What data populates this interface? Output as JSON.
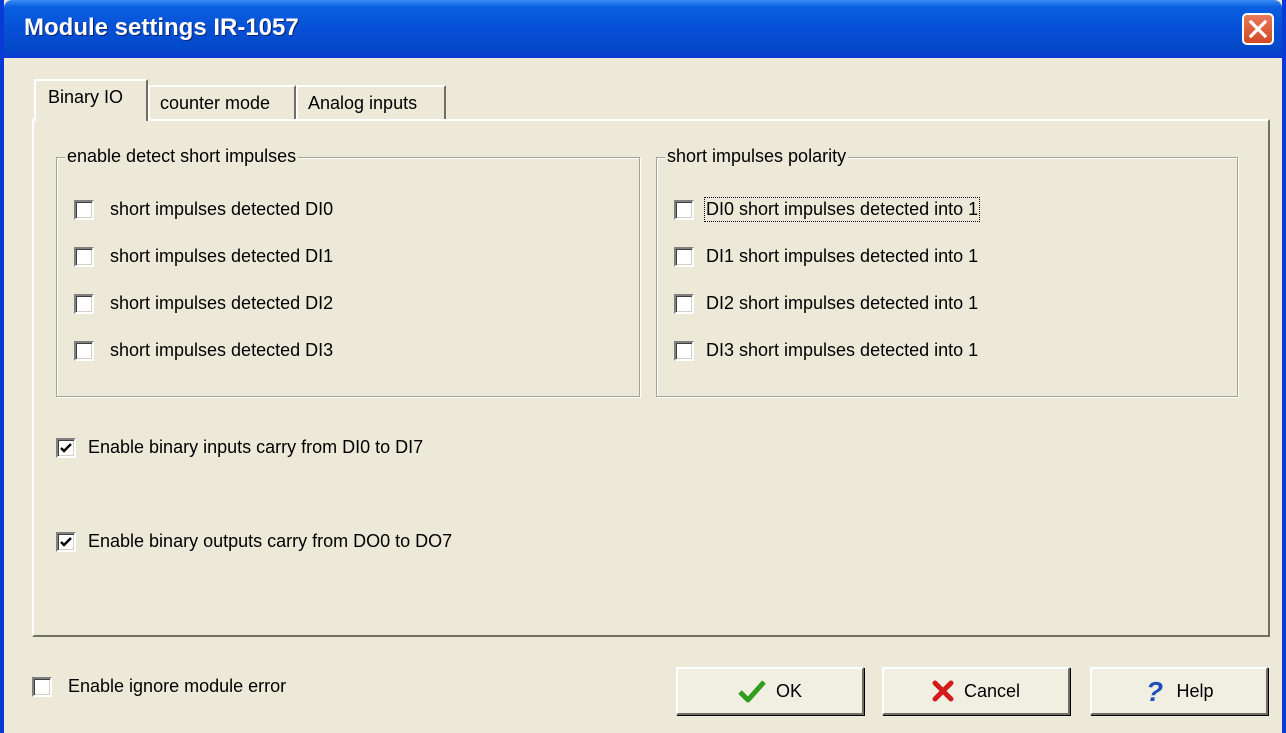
{
  "window": {
    "title": "Module settings IR-1057",
    "close_icon": "close-x-icon"
  },
  "tabs": [
    {
      "label": "Binary IO",
      "active": true
    },
    {
      "label": "counter mode",
      "active": false
    },
    {
      "label": "Analog inputs",
      "active": false
    }
  ],
  "detect_group": {
    "title": "enable detect short impulses",
    "items": [
      {
        "label": "short impulses detected DI0",
        "checked": false
      },
      {
        "label": "short impulses detected DI1",
        "checked": false
      },
      {
        "label": "short impulses detected DI2",
        "checked": false
      },
      {
        "label": "short impulses detected DI3",
        "checked": false
      }
    ]
  },
  "polarity_group": {
    "title": "short impulses polarity",
    "items": [
      {
        "label": "DI0 short impulses detected into 1",
        "checked": false
      },
      {
        "label": "DI1 short impulses detected into 1",
        "checked": false
      },
      {
        "label": "DI2 short impulses detected into 1",
        "checked": false
      },
      {
        "label": "DI3 short impulses detected into 1",
        "checked": false
      }
    ]
  },
  "carry_inputs": {
    "label": "Enable binary inputs carry from DI0 to DI7",
    "checked": true
  },
  "carry_outputs": {
    "label": "Enable binary outputs carry from DO0 to DO7",
    "checked": true
  },
  "ignore_error": {
    "label": "Enable ignore module error",
    "checked": false
  },
  "buttons": {
    "ok": {
      "label": "OK",
      "icon": "green-checkmark-icon",
      "color": "#2f9e1f"
    },
    "cancel": {
      "label": "Cancel",
      "icon": "red-x-icon",
      "color": "#d31b1b"
    },
    "help": {
      "label": "Help",
      "icon": "blue-question-icon",
      "color": "#1c4fb8"
    }
  },
  "colors": {
    "titlebar": "#0650d6",
    "face": "#ece9d8",
    "close_button": "#d14a25"
  }
}
